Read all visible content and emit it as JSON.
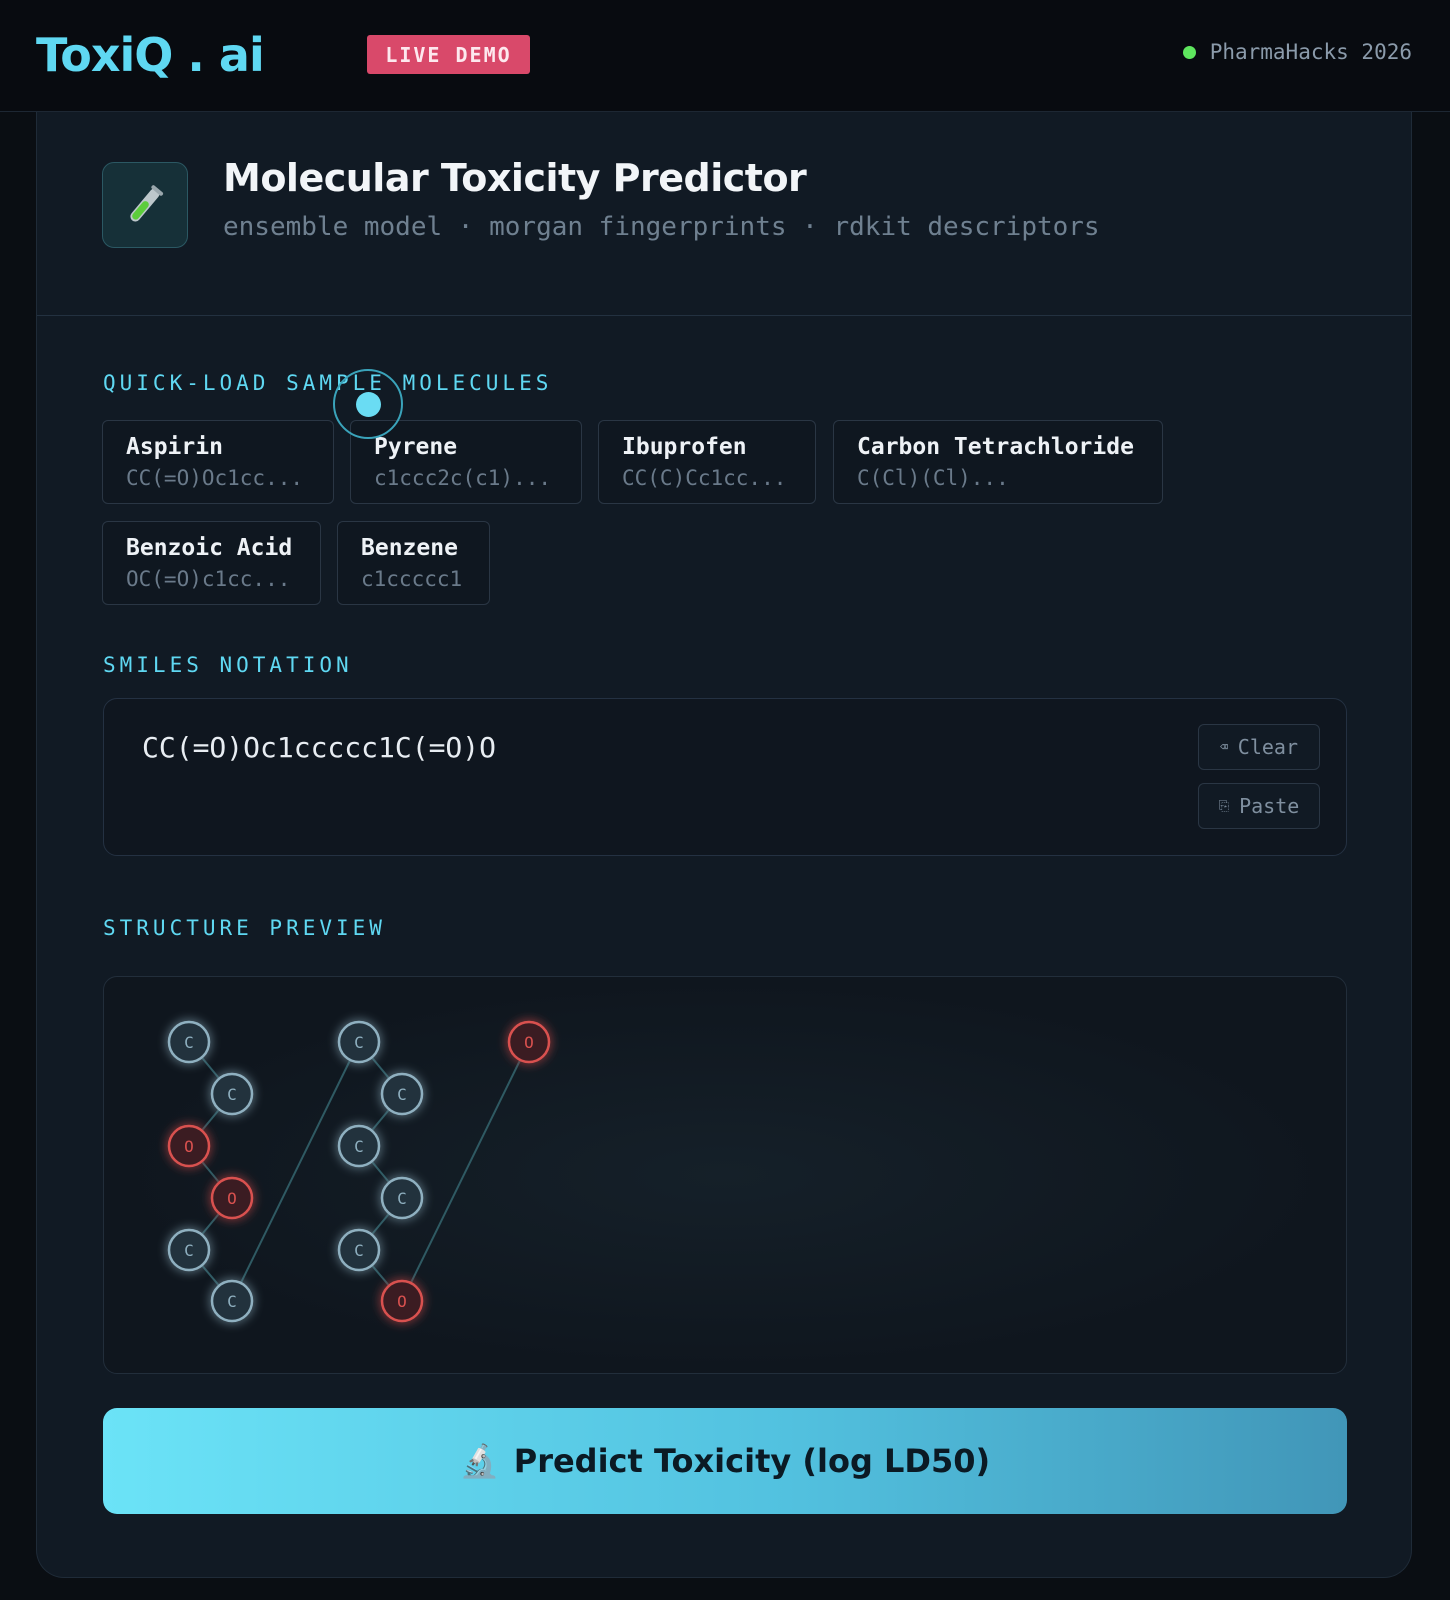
{
  "brand": {
    "logo": "ToxiQ . ai",
    "badge": "LIVE DEMO",
    "event": "PharmaHacks 2026"
  },
  "header": {
    "title": "Molecular Toxicity Predictor",
    "subtitle": "ensemble model · morgan fingerprints · rdkit descriptors",
    "icon": "test-tube-icon"
  },
  "samples": {
    "label": "QUICK-LOAD SAMPLE MOLECULES",
    "items": [
      {
        "name": "Aspirin",
        "smiles": "CC(=O)Oc1cc..."
      },
      {
        "name": "Pyrene",
        "smiles": "c1ccc2c(c1)..."
      },
      {
        "name": "Ibuprofen",
        "smiles": "CC(C)Cc1cc..."
      },
      {
        "name": "Carbon Tetrachloride",
        "smiles": "C(Cl)(Cl)..."
      },
      {
        "name": "Benzoic Acid",
        "smiles": "OC(=O)c1cc..."
      },
      {
        "name": "Benzene",
        "smiles": "c1ccccc1"
      }
    ]
  },
  "smiles_input": {
    "label": "SMILES NOTATION",
    "value": "CC(=O)Oc1ccccc1C(=O)O",
    "clear_label": "Clear",
    "paste_label": "Paste"
  },
  "structure": {
    "label": "STRUCTURE PREVIEW",
    "atoms": [
      "C",
      "C",
      "O",
      "O",
      "C",
      "C",
      "C",
      "C",
      "C",
      "C",
      "C",
      "O",
      "O"
    ]
  },
  "predict": {
    "label": "Predict Toxicity (log LD50)",
    "icon": "microscope-icon"
  },
  "colors": {
    "accent": "#5fd8f2",
    "badge": "#d9496a",
    "status": "#5ee65e",
    "carbon": "#8fb0c0",
    "oxygen": "#d9514f"
  }
}
